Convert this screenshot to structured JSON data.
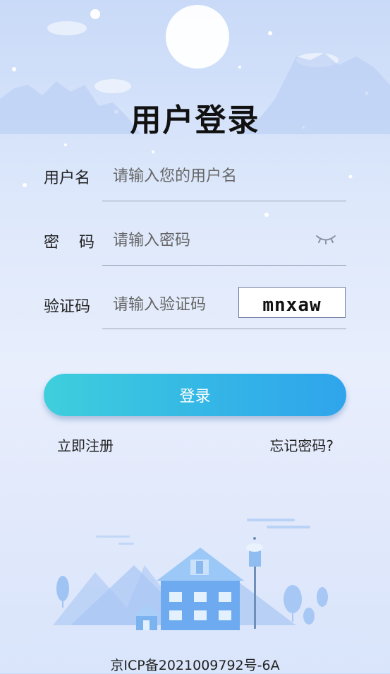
{
  "page": {
    "title": "用户登录"
  },
  "form": {
    "username": {
      "label": "用户名",
      "placeholder": "请输入您的用户名",
      "value": ""
    },
    "password": {
      "label": "密　码",
      "placeholder": "请输入密码",
      "value": "",
      "toggle_icon": "eye-closed-icon"
    },
    "captcha": {
      "label": "验证码",
      "placeholder": "请输入验证码",
      "value": "",
      "image_text": "mnxaw"
    }
  },
  "actions": {
    "login_label": "登录",
    "register_label": "立即注册",
    "forgot_label": "忘记密码?"
  },
  "footer": {
    "icp": "京ICP备2021009792号-6A"
  },
  "colors": {
    "button_start": "#3ecfdc",
    "button_end": "#2fa4ec",
    "background_top": "#c9daf8",
    "background_bottom": "#d9e5fb"
  }
}
